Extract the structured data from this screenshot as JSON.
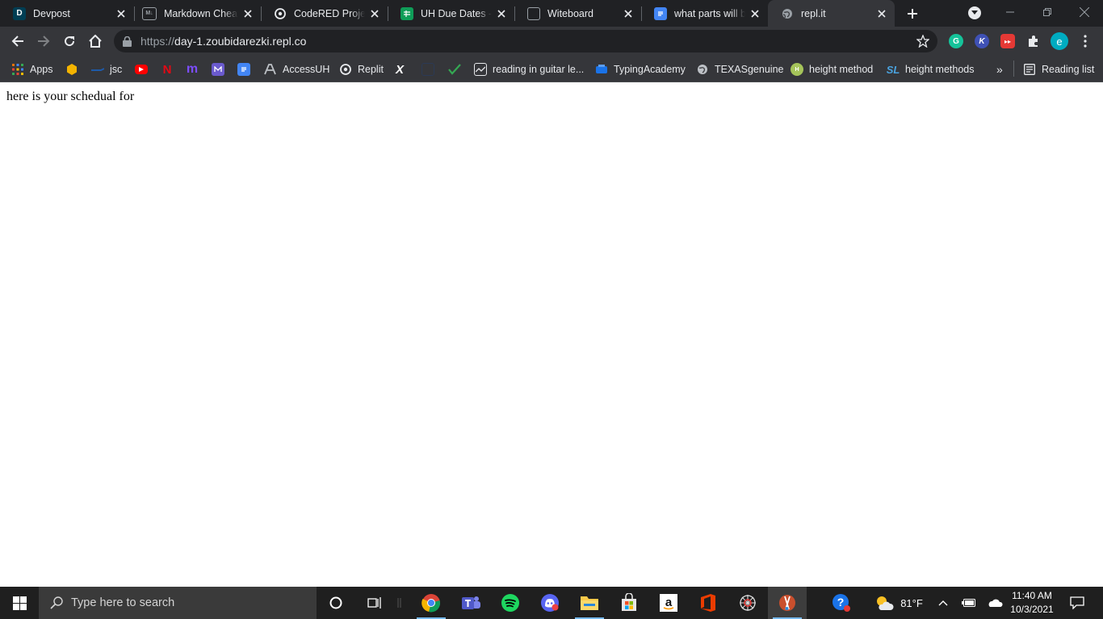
{
  "tabs": [
    {
      "title": "Devpost",
      "favicon": "devpost-icon"
    },
    {
      "title": "Markdown Cheatsheet",
      "favicon": "markdown-icon"
    },
    {
      "title": "CodeRED Project",
      "favicon": "replit-icon"
    },
    {
      "title": "UH Due Dates - G",
      "favicon": "sheets-icon"
    },
    {
      "title": "Witeboard",
      "favicon": "witeboard-icon"
    },
    {
      "title": "what parts will be",
      "favicon": "docs-icon"
    },
    {
      "title": "repl.it",
      "favicon": "globe-icon",
      "active": true
    }
  ],
  "address_bar": {
    "scheme": "https://",
    "host": "day-1.zoubidarezki.repl.co"
  },
  "extensions": [
    {
      "name": "grammarly-icon",
      "letter": "G",
      "color": "#15c39a"
    },
    {
      "name": "kami-icon",
      "letter": "K",
      "color": "#3f51b5"
    },
    {
      "name": "video-speed-icon",
      "letter": "▸▸",
      "color": "#e53935"
    },
    {
      "name": "profile-avatar",
      "letter": "e",
      "color": "#00acc1"
    }
  ],
  "bookmarks": {
    "apps": "Apps",
    "jsc": "jsc",
    "accessuh": "AccessUH",
    "replit": "Replit",
    "x": "X",
    "guitar": "reading in guitar le...",
    "typing": "TypingAcademy",
    "texas": "TEXASgenuine",
    "height1": "height method",
    "height2": "height methods",
    "more": "»",
    "reading_list": "Reading list"
  },
  "page": {
    "text": "here is your schedual for"
  },
  "taskbar": {
    "search_placeholder": "Type here to search",
    "weather": "81°F",
    "time": "11:40 AM",
    "date": "10/3/2021"
  }
}
